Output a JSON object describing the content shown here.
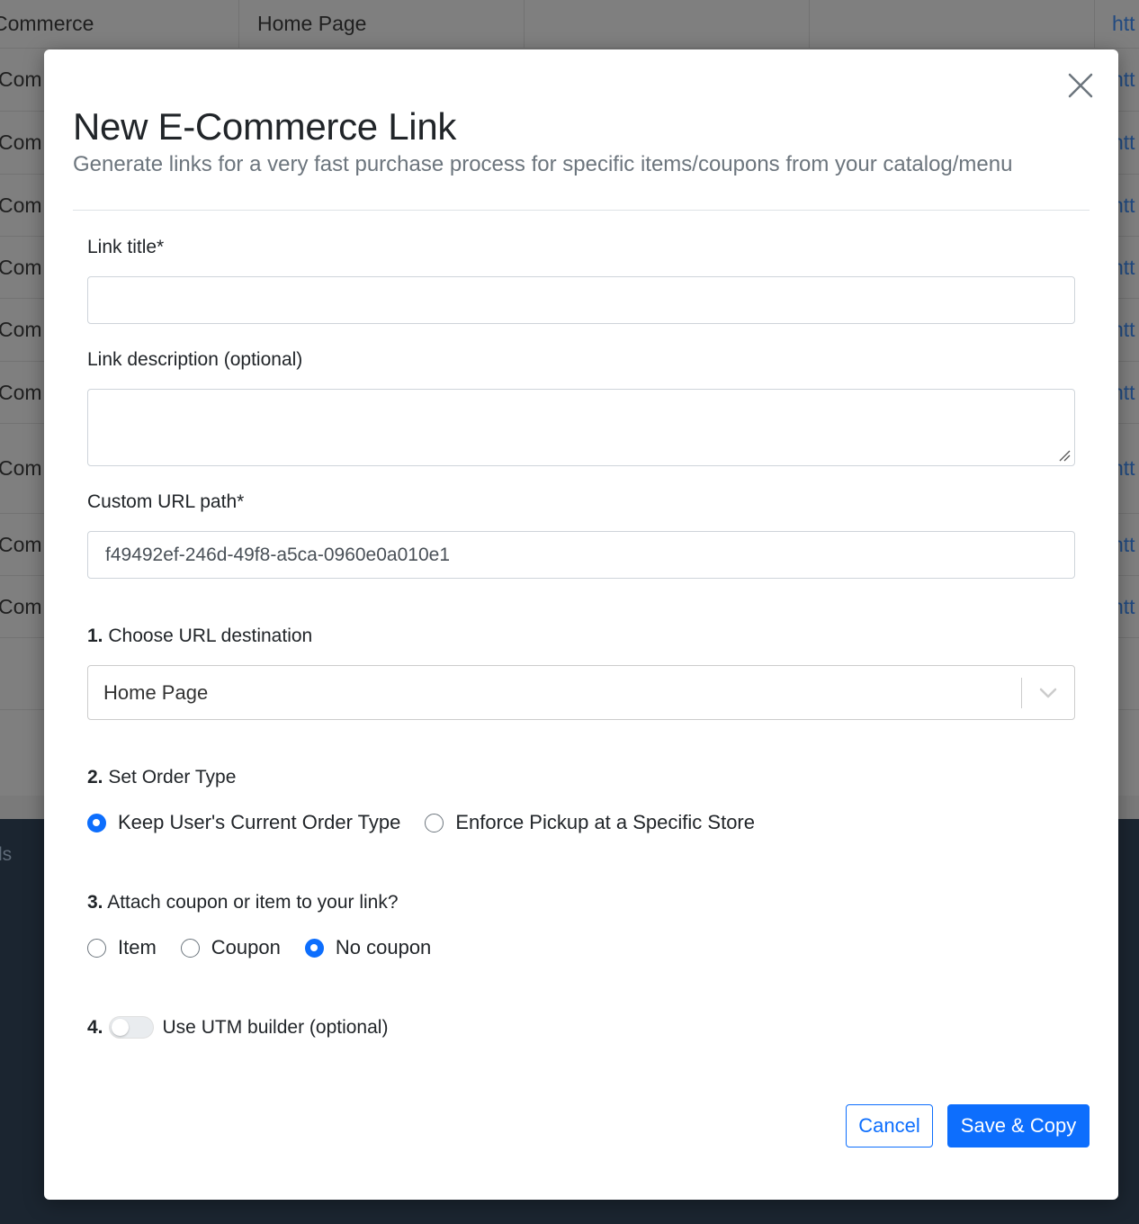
{
  "background": {
    "header_row": {
      "col1": "Commerce",
      "col2": "Home Page",
      "col6": "htt"
    },
    "row_col1": "Com",
    "row_col6": "htt",
    "footer_text": "ls"
  },
  "modal": {
    "title": "New E-Commerce Link",
    "subtitle": "Generate links for a very fast purchase process for specific items/coupons from your catalog/menu",
    "fields": {
      "link_title": {
        "label": "Link title*",
        "value": "",
        "placeholder": ""
      },
      "link_description": {
        "label": "Link description (optional)",
        "value": ""
      },
      "custom_url_path": {
        "label": "Custom URL path*",
        "value": "f49492ef-246d-49f8-a5ca-0960e0a010e1"
      }
    },
    "step1": {
      "number": "1.",
      "label": "Choose URL destination",
      "selected": "Home Page"
    },
    "step2": {
      "number": "2.",
      "label": "Set Order Type",
      "options": [
        {
          "label": "Keep User's Current Order Type",
          "checked": true
        },
        {
          "label": "Enforce Pickup at a Specific Store",
          "checked": false
        }
      ]
    },
    "step3": {
      "number": "3.",
      "label": "Attach coupon or item to your link?",
      "options": [
        {
          "label": "Item",
          "checked": false
        },
        {
          "label": "Coupon",
          "checked": false
        },
        {
          "label": "No coupon",
          "checked": true
        }
      ]
    },
    "step4": {
      "number": "4.",
      "label": "Use UTM builder (optional)",
      "enabled": false
    },
    "buttons": {
      "cancel": "Cancel",
      "save": "Save & Copy"
    }
  },
  "colors": {
    "primary": "#0d6efd",
    "text": "#212529",
    "muted": "#6c757d",
    "backdrop": "#7f7f7f",
    "footer": "#1b2530"
  },
  "icons": {
    "close": "close-icon",
    "chevron": "chevron-down-icon",
    "toggle": "toggle-switch"
  }
}
